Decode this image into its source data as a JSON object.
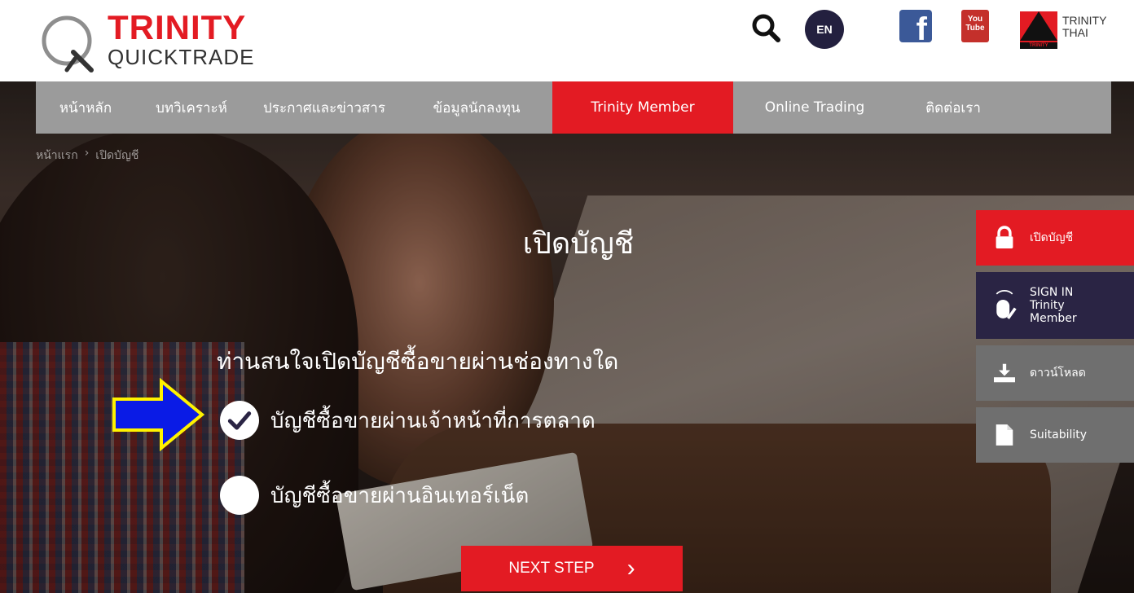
{
  "header": {
    "logo_title": "TRINITY",
    "logo_sub": "QUICKTRADE",
    "lang": "EN",
    "youtube": "You\nTube",
    "trinity_thai": "TRINITY\nTHAI",
    "trinity_strip": "TRINITY"
  },
  "nav": {
    "items": [
      {
        "label": "หน้าหลัก"
      },
      {
        "label": "บทวิเคราะห์"
      },
      {
        "label": "ประกาศและข่าวสาร"
      },
      {
        "label": "ข้อมูลนักลงทุน"
      },
      {
        "label": "Trinity Member"
      },
      {
        "label": "Online Trading"
      },
      {
        "label": "ติดต่อเรา"
      }
    ]
  },
  "breadcrumb": {
    "home": "หน้าแรก",
    "separator": "›",
    "current": "เปิดบัญชี"
  },
  "main": {
    "title": "เปิดบัญชี",
    "question": "ท่านสนใจเปิดบัญชีซื้อขายผ่านช่องทางใด",
    "options": [
      {
        "label": "บัญชีซื้อขายผ่านเจ้าหน้าที่การตลาด",
        "selected": true
      },
      {
        "label": "บัญชีซื้อขายผ่านอินเทอร์เน็ต",
        "selected": false
      }
    ],
    "next_button": "NEXT STEP",
    "next_arrow": "›"
  },
  "side_menu": {
    "open_account": "เปิดบัญชี",
    "signin": "SIGN IN\nTrinity\nMember",
    "download": "ดาวน์โหลด",
    "suitability": "Suitability"
  },
  "colors": {
    "brand_red": "#e31b23",
    "nav_gray": "#9b9b9b",
    "signin_navy": "#2a2444",
    "annotation_arrow_fill": "#0a1be6",
    "annotation_arrow_stroke": "#fff200"
  }
}
